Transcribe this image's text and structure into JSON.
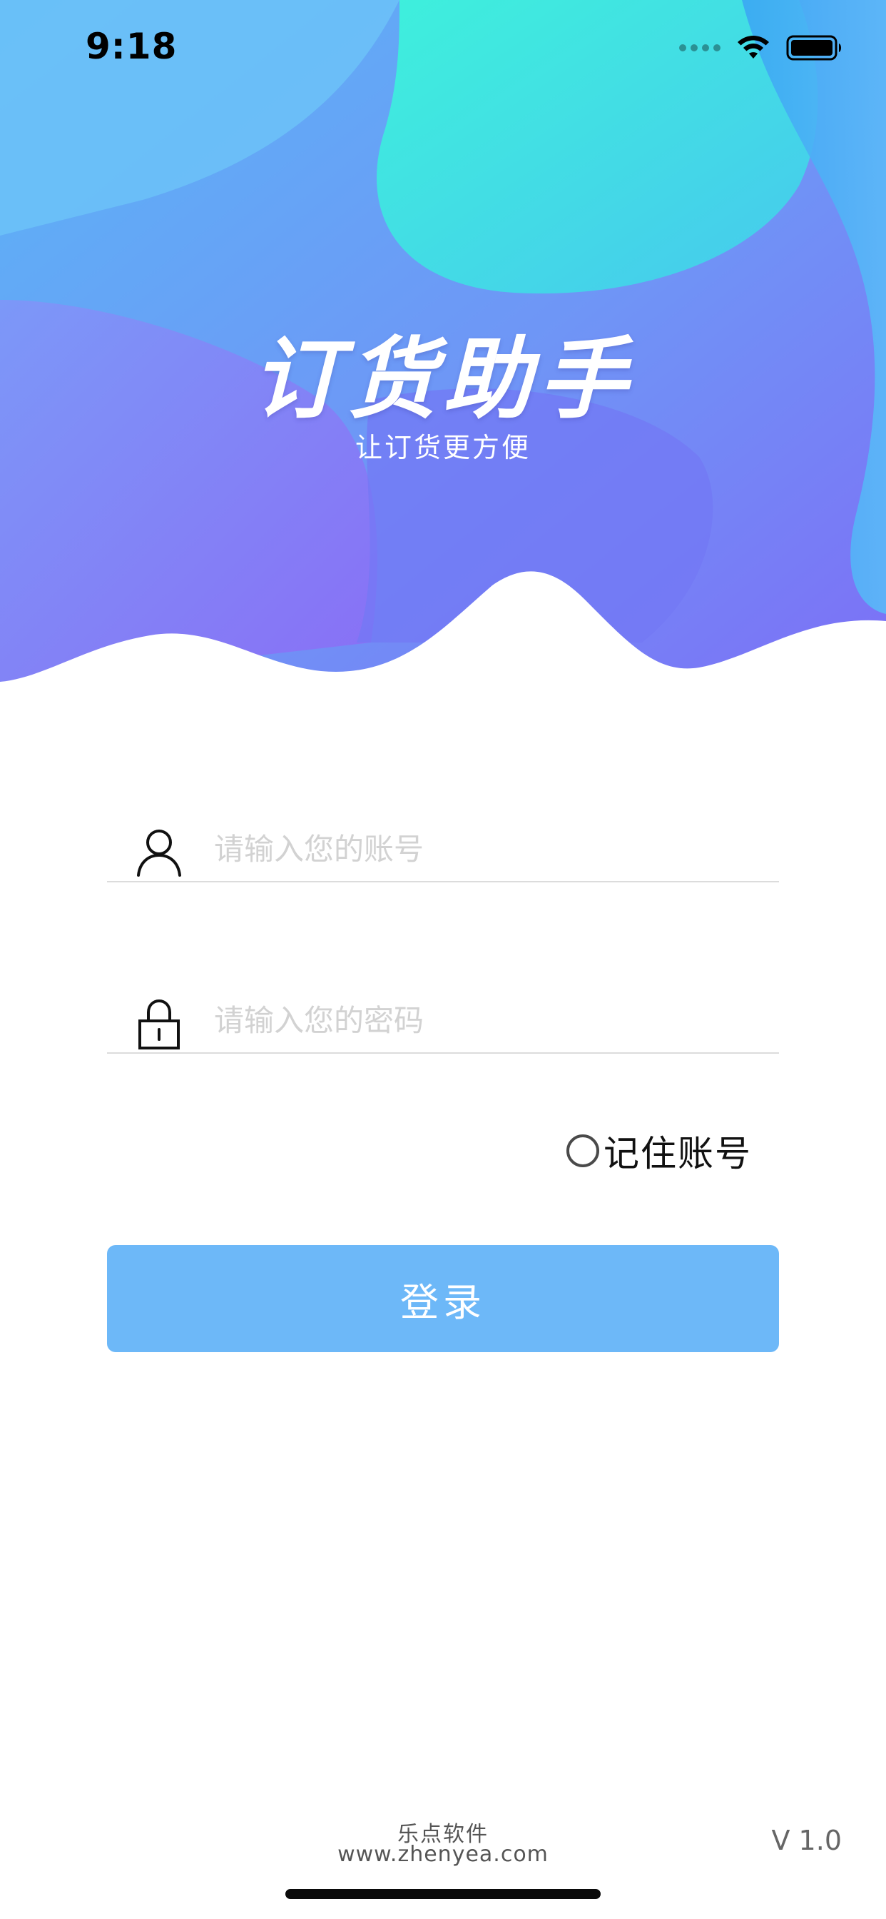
{
  "status_bar": {
    "time": "9:18",
    "icons": [
      "cellular-signal-icon",
      "wifi-icon",
      "battery-icon"
    ]
  },
  "header": {
    "title": "订货助手",
    "subtitle": "让订货更方便"
  },
  "form": {
    "account": {
      "icon": "user-icon",
      "placeholder": "请输入您的账号",
      "value": ""
    },
    "password": {
      "icon": "lock-icon",
      "placeholder": "请输入您的密码",
      "value": ""
    },
    "remember": {
      "label": "记住账号",
      "checked": false
    },
    "login_label": "登录"
  },
  "footer": {
    "company": "乐点软件",
    "url": "www.zhenyea.com",
    "version": "V 1.0"
  },
  "colors": {
    "primary_button": "#6db8f8",
    "header_gradient_start": "#5fb0f5",
    "header_gradient_mid": "#7a86f5",
    "header_accent_teal": "#3ee6e0",
    "placeholder": "#d2d2d2",
    "divider": "#dcdcdc"
  }
}
